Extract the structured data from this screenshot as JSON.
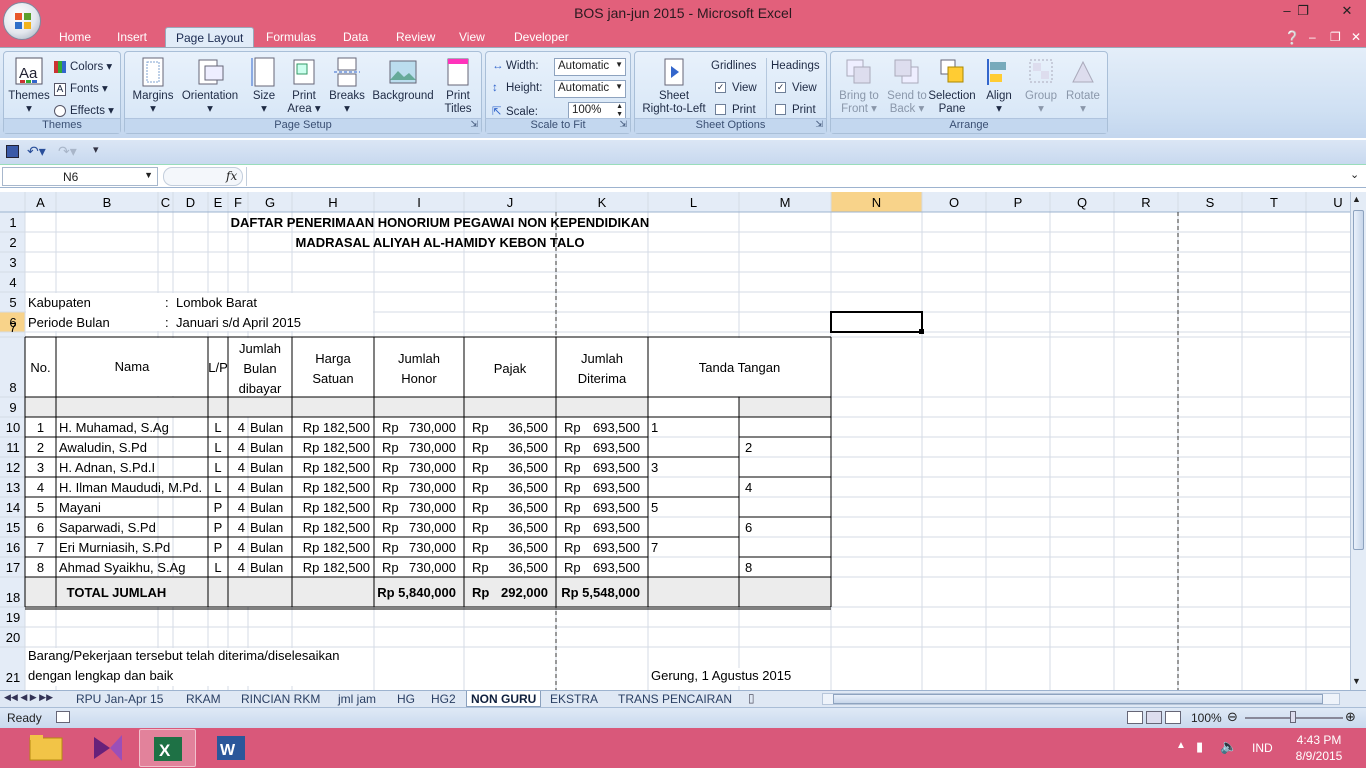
{
  "window": {
    "title": "BOS jan-jun 2015 - Microsoft Excel"
  },
  "ribbon_tabs": [
    "Home",
    "Insert",
    "Page Layout",
    "Formulas",
    "Data",
    "Review",
    "View",
    "Developer"
  ],
  "ribbon": {
    "themes": {
      "themes": "Themes",
      "colors": "Colors",
      "fonts": "Fonts",
      "effects": "Effects",
      "group": "Themes"
    },
    "page_setup": {
      "margins": "Margins",
      "orientation": "Orientation",
      "size": "Size",
      "print_area_1": "Print",
      "print_area_2": "Area",
      "breaks": "Breaks",
      "background": "Background",
      "print_titles_1": "Print",
      "print_titles_2": "Titles",
      "group": "Page Setup"
    },
    "scale_to_fit": {
      "width_label": "Width:",
      "width_value": "Automatic",
      "height_label": "Height:",
      "height_value": "Automatic",
      "scale_label": "Scale:",
      "scale_value": "100%",
      "group": "Scale to Fit"
    },
    "sheet_options": {
      "sheet_rtl_1": "Sheet",
      "sheet_rtl_2": "Right-to-Left",
      "gridlines": "Gridlines",
      "headings": "Headings",
      "view": "View",
      "print": "Print",
      "group": "Sheet Options"
    },
    "arrange": {
      "bring_front_1": "Bring to",
      "bring_front_2": "Front",
      "send_back_1": "Send to",
      "send_back_2": "Back",
      "selection_pane_1": "Selection",
      "selection_pane_2": "Pane",
      "align": "Align",
      "group_btn": "Group",
      "rotate": "Rotate",
      "group": "Arrange"
    }
  },
  "formula_bar": {
    "name_box": "N6",
    "fx": "fx",
    "formula": ""
  },
  "columns": [
    "A",
    "B",
    "C",
    "D",
    "E",
    "F",
    "G",
    "H",
    "I",
    "J",
    "K",
    "L",
    "M",
    "N",
    "O",
    "P",
    "Q",
    "R",
    "S",
    "T",
    "U"
  ],
  "rows": [
    "1",
    "2",
    "3",
    "4",
    "5",
    "6",
    "7",
    "8",
    "9",
    "10",
    "11",
    "12",
    "13",
    "14",
    "15",
    "16",
    "17",
    "18",
    "19",
    "20",
    "21"
  ],
  "sheet": {
    "title1": "DAFTAR PENERIMAAN HONORIUM PEGAWAI NON KEPENDIDIKAN",
    "title2": "MADRASAL ALIYAH AL-HAMIDY KEBON TALO",
    "kab_label": "Kabupaten",
    "kab_value": "Lombok Barat",
    "periode_label": "Periode Bulan",
    "periode_value": "Januari s/d April 2015",
    "colon": ":",
    "headers": {
      "no": "No.",
      "nama": "Nama",
      "lp": "L/P",
      "jb1": "Jumlah",
      "jb2": "Bulan",
      "jb3": "dibayar",
      "hs1": "Harga",
      "hs2": "Satuan",
      "jh1": "Jumlah",
      "jh2": "Honor",
      "pajak": "Pajak",
      "jd1": "Jumlah",
      "jd2": "Diterima",
      "ttd": "Tanda Tangan"
    },
    "rows": [
      {
        "no": "1",
        "nama": "H. Muhamad, S.Ag",
        "lp": "L",
        "bln": "4",
        "unit": "Bulan",
        "harga": "Rp 182,500",
        "rp": "Rp",
        "honor": "730,000",
        "pajak": "36,500",
        "diterima": "693,500",
        "sig": "1"
      },
      {
        "no": "2",
        "nama": "Awaludin, S.Pd",
        "lp": "L",
        "bln": "4",
        "unit": "Bulan",
        "harga": "Rp 182,500",
        "rp": "Rp",
        "honor": "730,000",
        "pajak": "36,500",
        "diterima": "693,500",
        "sig": "2"
      },
      {
        "no": "3",
        "nama": "H. Adnan, S.Pd.I",
        "lp": "L",
        "bln": "4",
        "unit": "Bulan",
        "harga": "Rp 182,500",
        "rp": "Rp",
        "honor": "730,000",
        "pajak": "36,500",
        "diterima": "693,500",
        "sig": "3"
      },
      {
        "no": "4",
        "nama": "H. Ilman Maududi, M.Pd.",
        "lp": "L",
        "bln": "4",
        "unit": "Bulan",
        "harga": "Rp 182,500",
        "rp": "Rp",
        "honor": "730,000",
        "pajak": "36,500",
        "diterima": "693,500",
        "sig": "4"
      },
      {
        "no": "5",
        "nama": "Mayani",
        "lp": "P",
        "bln": "4",
        "unit": "Bulan",
        "harga": "Rp 182,500",
        "rp": "Rp",
        "honor": "730,000",
        "pajak": "36,500",
        "diterima": "693,500",
        "sig": "5"
      },
      {
        "no": "6",
        "nama": "Saparwadi, S.Pd",
        "lp": "P",
        "bln": "4",
        "unit": "Bulan",
        "harga": "Rp 182,500",
        "rp": "Rp",
        "honor": "730,000",
        "pajak": "36,500",
        "diterima": "693,500",
        "sig": "6"
      },
      {
        "no": "7",
        "nama": "Eri Murniasih, S.Pd",
        "lp": "P",
        "bln": "4",
        "unit": "Bulan",
        "harga": "Rp 182,500",
        "rp": "Rp",
        "honor": "730,000",
        "pajak": "36,500",
        "diterima": "693,500",
        "sig": "7"
      },
      {
        "no": "8",
        "nama": "Ahmad Syaikhu, S.Ag",
        "lp": "L",
        "bln": "4",
        "unit": "Bulan",
        "harga": "Rp 182,500",
        "rp": "Rp",
        "honor": "730,000",
        "pajak": "36,500",
        "diterima": "693,500",
        "sig": "8"
      }
    ],
    "total_label": "TOTAL JUMLAH",
    "total_honor": "Rp 5,840,000",
    "total_pajak_rp": "Rp",
    "total_pajak": "292,000",
    "total_diterima": "Rp 5,548,000",
    "footer1": "Barang/Pekerjaan tersebut telah diterima/diselesaikan",
    "footer2": "dengan lengkap dan baik",
    "place_date": "Gerung, 1 Agustus 2015"
  },
  "sheet_tabs": [
    "RPU Jan-Apr 15",
    "RKAM",
    "RINCIAN RKM",
    "jml jam",
    "HG",
    "HG2",
    "NON GURU",
    "EKSTRA",
    "TRANS PENCAIRAN"
  ],
  "active_sheet": "NON GURU",
  "status": {
    "ready": "Ready",
    "zoom": "100%"
  },
  "taskbar": {
    "lang": "IND",
    "time": "4:43 PM",
    "date": "8/9/2015"
  }
}
